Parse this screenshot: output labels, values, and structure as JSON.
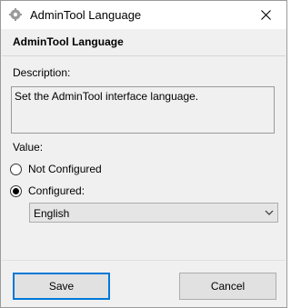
{
  "window": {
    "title": "AdminTool Language",
    "icon": "gear-icon"
  },
  "heading": "AdminTool Language",
  "description": {
    "label": "Description:",
    "text": "Set the AdminTool interface language."
  },
  "value": {
    "label": "Value:",
    "options": [
      {
        "label": "Not Configured",
        "selected": false
      },
      {
        "label": "Configured:",
        "selected": true
      }
    ],
    "language_selected": "English"
  },
  "buttons": {
    "save": "Save",
    "cancel": "Cancel"
  },
  "colors": {
    "accent": "#0078d7",
    "dialog_bg": "#f0f0f0"
  }
}
